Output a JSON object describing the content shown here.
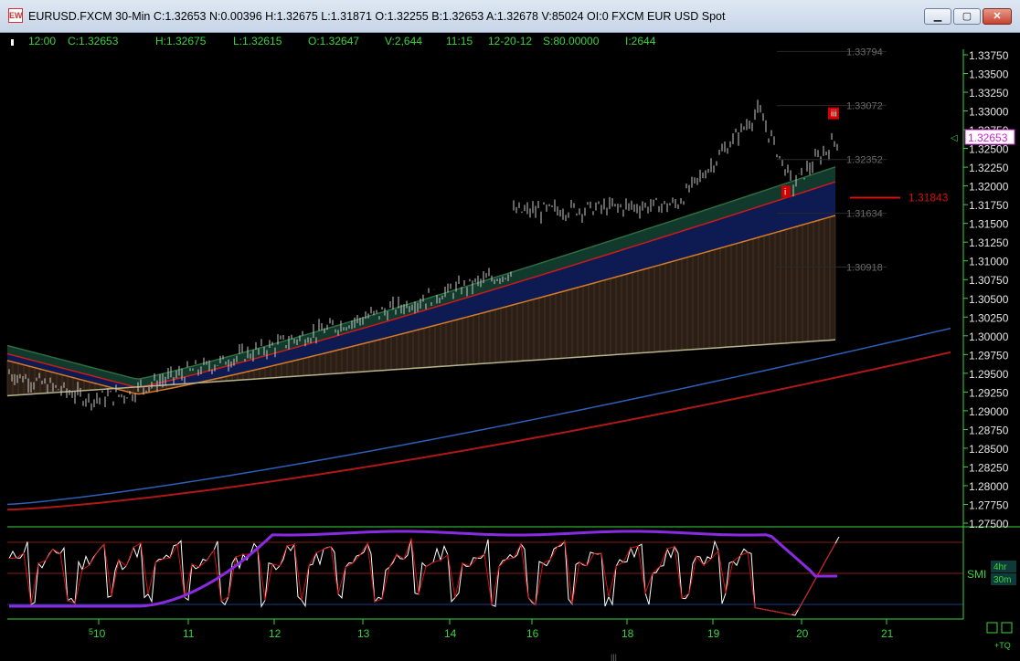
{
  "window": {
    "title": "EURUSD.FXCM 30-Min C:1.32653 N:0.00396 H:1.32675 L:1.31871 O:1.32255 B:1.32653 A:1.32678 V:85024 OI:0 FXCM EUR USD Spot",
    "icon_label": "EW",
    "minimize_icon": "minimize-icon",
    "maximize_icon": "maximize-icon",
    "close_icon": "close-icon"
  },
  "infoline": {
    "time": "12:00",
    "close": "C:1.32653",
    "high": "H:1.32675",
    "low": "L:1.32615",
    "open": "O:1.32647",
    "volume": "V:2,644",
    "bar_time": "11:15",
    "date": "12-20-12",
    "s": "S:80.00000",
    "i": "I:2644"
  },
  "colors": {
    "background": "#000000",
    "axis": "#3bd33b",
    "info_text": "#3bd33b",
    "current_price_tag": "#d21fd2",
    "red_line": "#d51010",
    "smi_signal": "#8a2be2",
    "ma_blue": "#2d5fb8",
    "ma_red": "#b01818",
    "ma_khaki": "#b7b38a"
  },
  "price_axis": {
    "ticks": [
      "1.33750",
      "1.33500",
      "1.33250",
      "1.33000",
      "1.32750",
      "1.32500",
      "1.32250",
      "1.32000",
      "1.31750",
      "1.31500",
      "1.31250",
      "1.31000",
      "1.30750",
      "1.30500",
      "1.30250",
      "1.30000",
      "1.29750",
      "1.29500",
      "1.29250",
      "1.29000",
      "1.28750",
      "1.28500",
      "1.28250",
      "1.28000",
      "1.27750",
      "1.27500"
    ],
    "current_price": "1.32653",
    "red_level": "1.31843"
  },
  "level_labels": [
    {
      "text": "1.33794",
      "price": 1.33794,
      "left": "1.33794"
    },
    {
      "text": "1.33072",
      "price": 1.33072,
      "left": "1.33072",
      "mid": "1.33072"
    },
    {
      "text": "1.32352",
      "price": 1.32352
    },
    {
      "text": "1.31634",
      "price": 1.31634
    },
    {
      "text": "1.30918",
      "price": 1.30918
    }
  ],
  "wave_markers": [
    {
      "label": "iii",
      "price": 1.3295
    },
    {
      "label": "i",
      "price": 1.3193
    }
  ],
  "date_axis": {
    "labels": [
      "10",
      "11",
      "12",
      "13",
      "14",
      "16",
      "18",
      "19",
      "20",
      "21"
    ],
    "month_marker": "5"
  },
  "indicator": {
    "name": "SMI",
    "timeframe_1": "4hr",
    "timeframe_2": "30m",
    "levels": [
      80,
      0,
      -80
    ]
  },
  "status": {
    "bottom_right": "+TQ",
    "zoom_icon": "zoom-box-icon",
    "grid_icon": "grid-box-icon",
    "splitter": "|||"
  }
}
